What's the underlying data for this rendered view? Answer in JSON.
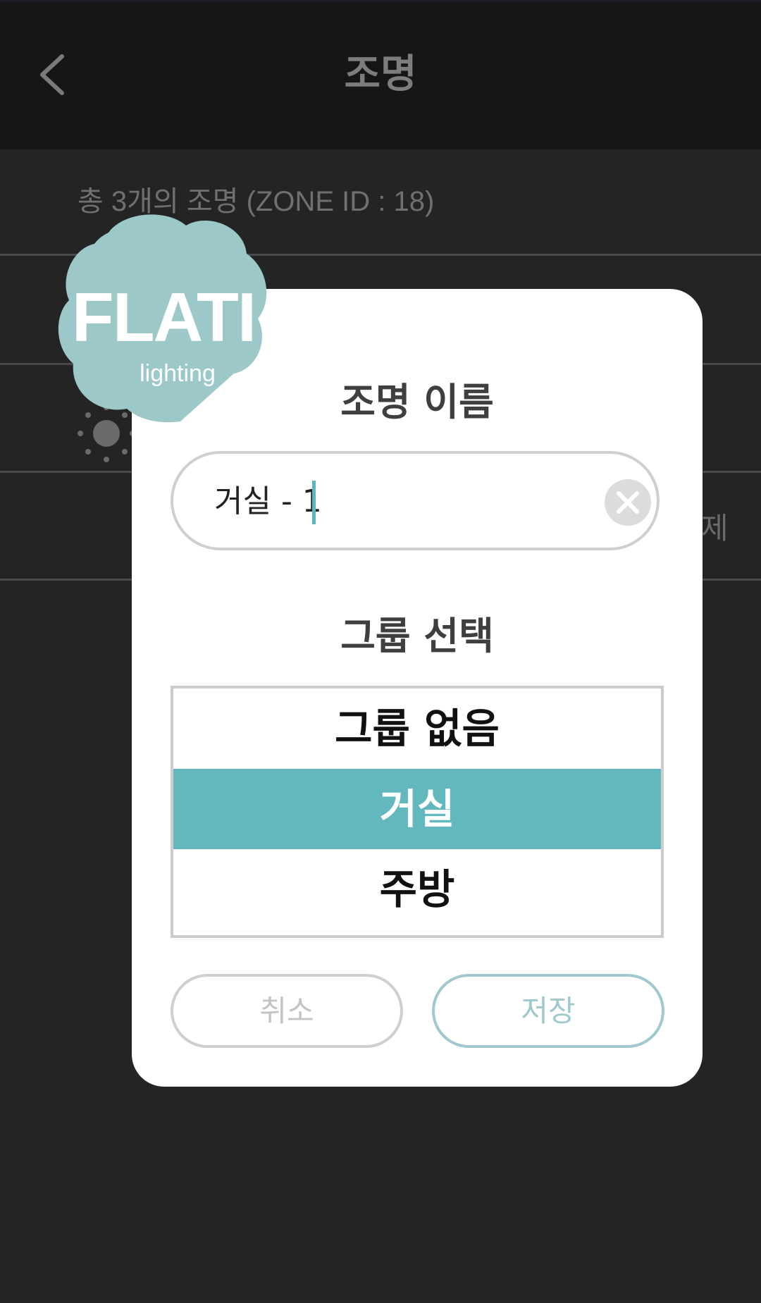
{
  "header": {
    "title": "조명",
    "back_icon": "chevron-left-icon"
  },
  "summary_text": "총 3개의 조명 (ZONE ID : 18)",
  "background_partial_text": "제",
  "logo": {
    "title": "FLATI",
    "subtitle": "lighting"
  },
  "dialog": {
    "name_title": "조명 이름",
    "name_value": "거실 - 1",
    "clear_icon": "clear-icon",
    "group_title": "그룹 선택",
    "groups": [
      {
        "label": "그룹 없음",
        "selected": false
      },
      {
        "label": "거실",
        "selected": true
      },
      {
        "label": "주방",
        "selected": false
      }
    ],
    "cancel_label": "취소",
    "save_label": "저장"
  },
  "colors": {
    "accent": "#62b8bc",
    "background": "#242424",
    "topbar": "#161616",
    "logo": "#9cc8c9"
  }
}
